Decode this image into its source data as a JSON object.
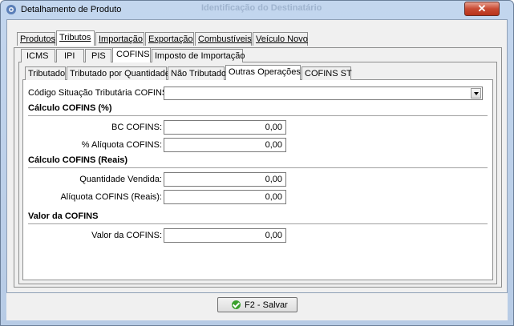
{
  "window": {
    "title": "Detalhamento de Produto",
    "background_title": "Identificação do Destinatário",
    "close_symbol": "✕"
  },
  "tabs_main": [
    {
      "label": "Produtos",
      "active": false
    },
    {
      "label": "Tributos",
      "active": true
    },
    {
      "label": "Importação",
      "active": false
    },
    {
      "label": "Exportação",
      "active": false
    },
    {
      "label": "Combustíveis",
      "active": false
    },
    {
      "label": "Veículo Novo",
      "active": false
    }
  ],
  "tabs_tax": [
    {
      "label": "ICMS",
      "active": false
    },
    {
      "label": "IPI",
      "active": false
    },
    {
      "label": "PIS",
      "active": false
    },
    {
      "label": "COFINS",
      "active": true
    },
    {
      "label": "Imposto de Importação",
      "active": false
    }
  ],
  "tabs_cofins": [
    {
      "label": "Tributado",
      "active": false
    },
    {
      "label": "Tributado por Quantidade",
      "active": false
    },
    {
      "label": "Não Tributado",
      "active": false
    },
    {
      "label": "Outras Operações",
      "active": true
    },
    {
      "label": "COFINS ST",
      "active": false
    }
  ],
  "form": {
    "cst_label": "Código Situação Tributária COFINS:",
    "cst_value": "",
    "section_percent": "Cálculo COFINS (%)",
    "bc_label": "BC COFINS:",
    "bc_value": "0,00",
    "aliquota_label": "% Alíquota COFINS:",
    "aliquota_value": "0,00",
    "section_reais": "Cálculo COFINS (Reais)",
    "qtd_label": "Quantidade Vendida:",
    "qtd_value": "0,00",
    "aliquota_reais_label": "Alíquota COFINS (Reais):",
    "aliquota_reais_value": "0,00",
    "section_valor": "Valor da COFINS",
    "valor_label": "Valor da COFINS:",
    "valor_value": "0,00"
  },
  "buttons": {
    "save_label": "F2 - Salvar"
  },
  "icons": {
    "window_icon": "app-gear-icon",
    "save_icon": "check-circle-icon"
  }
}
